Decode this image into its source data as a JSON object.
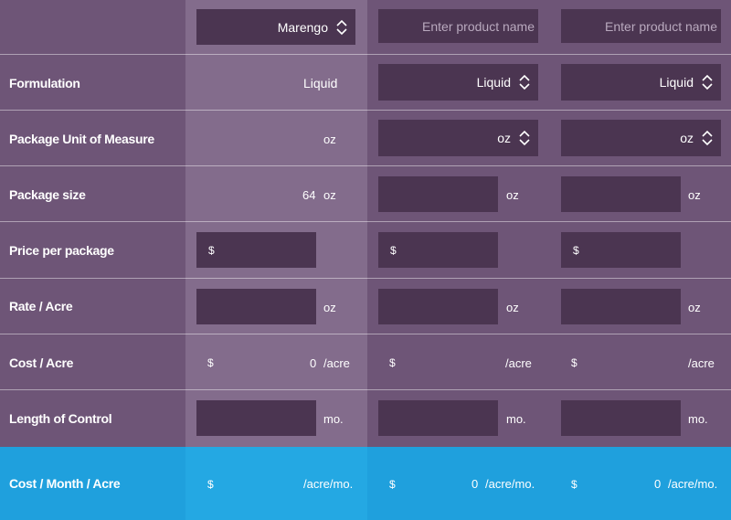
{
  "header": {
    "col1": {
      "selected": "Marengo"
    },
    "col2": {
      "placeholder": "Enter product name"
    },
    "col3": {
      "placeholder": "Enter product name"
    }
  },
  "rows": {
    "formulation": {
      "label": "Formulation",
      "col1": "Liquid",
      "col2": "Liquid",
      "col3": "Liquid"
    },
    "unit": {
      "label": "Package Unit of Measure",
      "col1": "oz",
      "col2": "oz",
      "col3": "oz"
    },
    "size": {
      "label": "Package size",
      "col1_value": "64",
      "col1_unit": "oz",
      "col2_unit": "oz",
      "col3_unit": "oz"
    },
    "price": {
      "label": "Price per package",
      "currency": "$"
    },
    "rate": {
      "label": "Rate / Acre",
      "unit": "oz"
    },
    "cost": {
      "label": "Cost / Acre",
      "currency": "$",
      "col1_value": "0",
      "unit": "/acre"
    },
    "length": {
      "label": "Length of Control",
      "unit": "mo."
    },
    "monthly": {
      "label": "Cost / Month / Acre",
      "currency": "$",
      "col2_value": "0",
      "col3_value": "0",
      "unit": "/acre/mo."
    }
  },
  "colors": {
    "highlight": "#1fa0dd",
    "field": "#4b3551",
    "background": "#6e5577"
  },
  "icons": {
    "select": "chevron-up-down-icon"
  }
}
